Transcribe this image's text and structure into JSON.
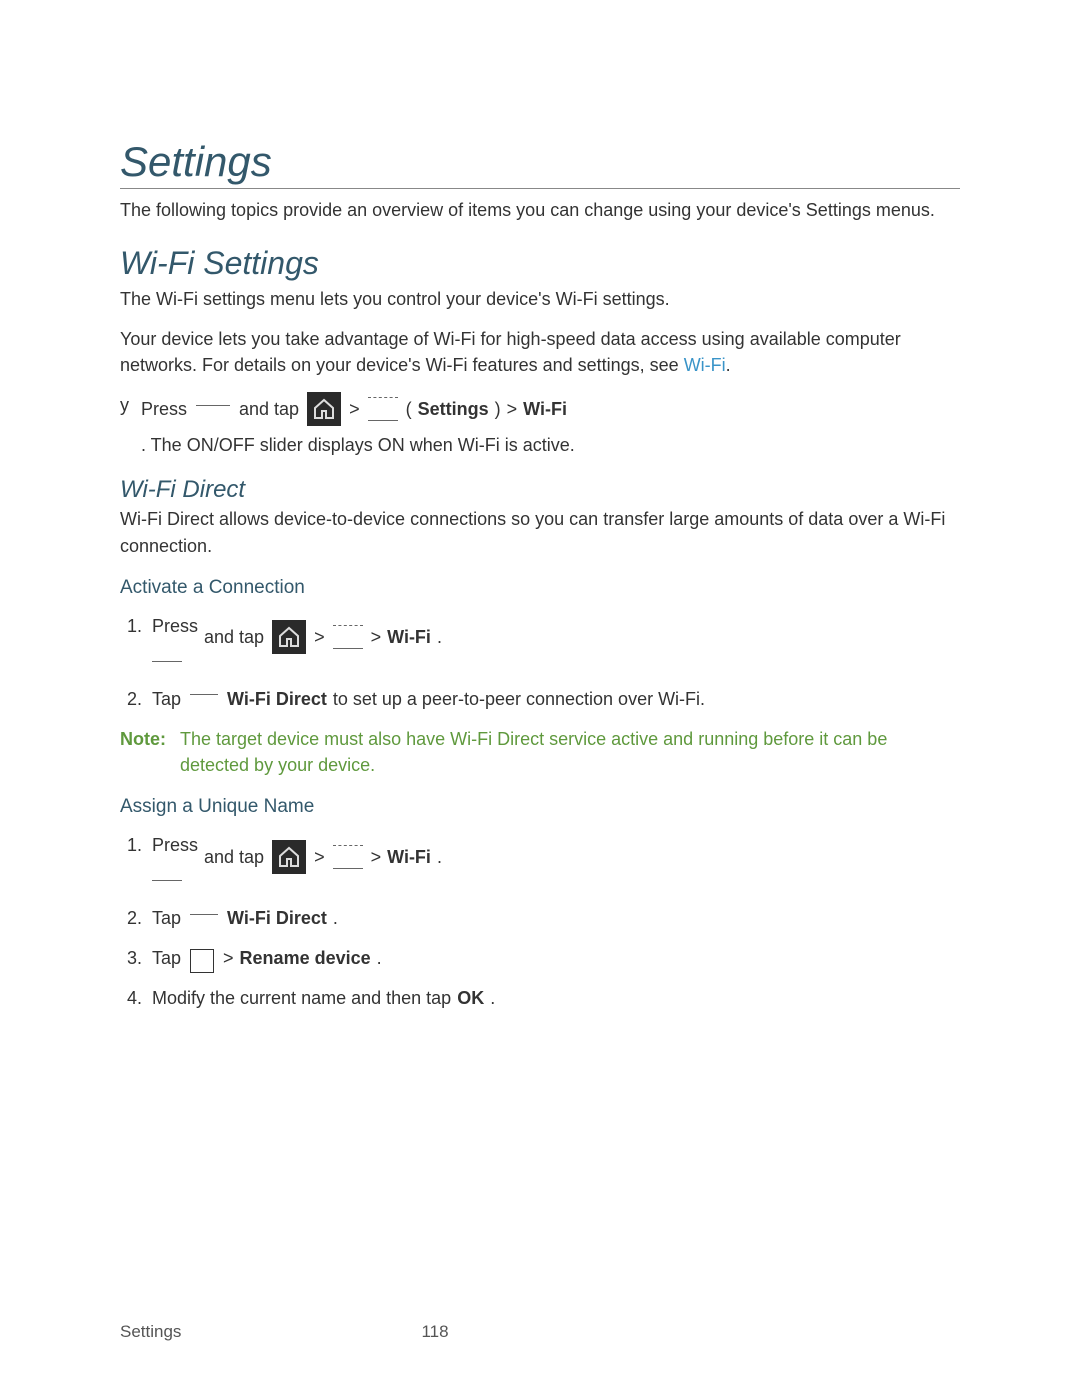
{
  "title": "Settings",
  "intro": "The following topics provide an overview of items you can change using your device's Settings menus.",
  "wifi": {
    "heading": "Wi-Fi Settings",
    "p1": "The Wi-Fi settings menu lets you control your device's Wi-Fi settings.",
    "p2_a": "Your device lets you take advantage of Wi-Fi for high-speed data access using available computer networks. For details on your device's Wi-Fi features and settings, see ",
    "p2_link": "Wi-Fi",
    "step_marker": "y",
    "step_press": "Press",
    "step_andtap": "and tap",
    "gt": ">",
    "open_paren": "(",
    "settings_bold": "Settings",
    "close_paren": ")",
    "wifi_bold": "Wi-Fi",
    "step_suffix": ". The ON/OFF slider displays ON when Wi-Fi is active."
  },
  "wifidirect": {
    "heading": "Wi-Fi Direct",
    "intro": "Wi-Fi Direct allows device-to-device connections so you can transfer large amounts of data over a Wi-Fi connection.",
    "activate": {
      "heading": "Activate a Connection",
      "n1": "1.",
      "n2": "2.",
      "press": "Press",
      "andtap": "and tap",
      "gt": ">",
      "wifi_bold": "Wi-Fi",
      "period": ".",
      "tap": "Tap",
      "wfd_bold": "Wi-Fi Direct",
      "s2_suffix": " to set up a peer-to-peer connection over Wi-Fi."
    },
    "note_label": "Note:",
    "note_text": "The target device must also have Wi-Fi Direct service active and running before it can be detected by your device.",
    "assign": {
      "heading": "Assign a Unique Name",
      "n1": "1.",
      "n2": "2.",
      "n3": "3.",
      "n4": "4.",
      "press": "Press",
      "andtap": "and tap",
      "gt": ">",
      "wifi_bold": "Wi-Fi",
      "period": ".",
      "tap": "Tap",
      "wfd_bold": "Wi-Fi Direct",
      "rename_bold": "Rename device",
      "s4": "Modify the current name and then tap ",
      "ok_bold": "OK",
      "s4_end": "."
    }
  },
  "footer": {
    "left": "Settings",
    "page": "118"
  }
}
